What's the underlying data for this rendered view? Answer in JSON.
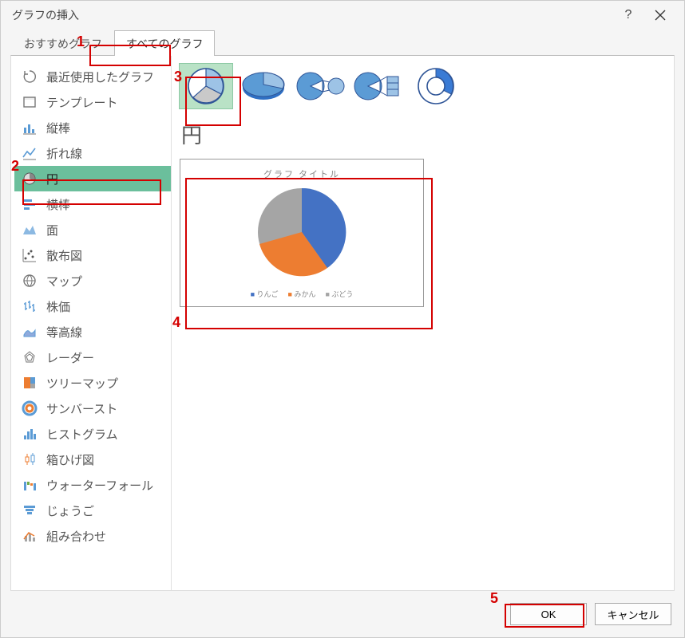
{
  "dialog": {
    "title": "グラフの挿入",
    "help_label": "?",
    "close_label": "×"
  },
  "tabs": {
    "recommended": "おすすめグラフ",
    "all": "すべてのグラフ"
  },
  "categories": [
    {
      "label": "最近使用したグラフ",
      "icon": "recent"
    },
    {
      "label": "テンプレート",
      "icon": "template"
    },
    {
      "label": "縦棒",
      "icon": "column"
    },
    {
      "label": "折れ線",
      "icon": "line"
    },
    {
      "label": "円",
      "icon": "pie"
    },
    {
      "label": "横棒",
      "icon": "bar"
    },
    {
      "label": "面",
      "icon": "area"
    },
    {
      "label": "散布図",
      "icon": "scatter"
    },
    {
      "label": "マップ",
      "icon": "map"
    },
    {
      "label": "株価",
      "icon": "stock"
    },
    {
      "label": "等高線",
      "icon": "surface"
    },
    {
      "label": "レーダー",
      "icon": "radar"
    },
    {
      "label": "ツリーマップ",
      "icon": "treemap"
    },
    {
      "label": "サンバースト",
      "icon": "sunburst"
    },
    {
      "label": "ヒストグラム",
      "icon": "histogram"
    },
    {
      "label": "箱ひげ図",
      "icon": "boxwhisker"
    },
    {
      "label": "ウォーターフォール",
      "icon": "waterfall"
    },
    {
      "label": "じょうご",
      "icon": "funnel"
    },
    {
      "label": "組み合わせ",
      "icon": "combo"
    }
  ],
  "selected_category_index": 4,
  "selected_category_name": "円",
  "subtypes": [
    {
      "name": "pie-2d"
    },
    {
      "name": "pie-3d"
    },
    {
      "name": "pie-of-pie"
    },
    {
      "name": "bar-of-pie"
    },
    {
      "name": "doughnut"
    }
  ],
  "selected_subtype_index": 0,
  "preview": {
    "title": "グラフ タイトル",
    "legend": [
      "りんご",
      "みかん",
      "ぶどう"
    ]
  },
  "chart_data": {
    "type": "pie",
    "title": "グラフ タイトル",
    "categories": [
      "りんご",
      "みかん",
      "ぶどう"
    ],
    "values": [
      40,
      35,
      25
    ],
    "colors": [
      "#4472c4",
      "#ed7d31",
      "#a5a5a5"
    ]
  },
  "footer": {
    "ok": "OK",
    "cancel": "キャンセル"
  },
  "annotations": {
    "n1": "1",
    "n2": "2",
    "n3": "3",
    "n4": "4",
    "n5": "5"
  }
}
